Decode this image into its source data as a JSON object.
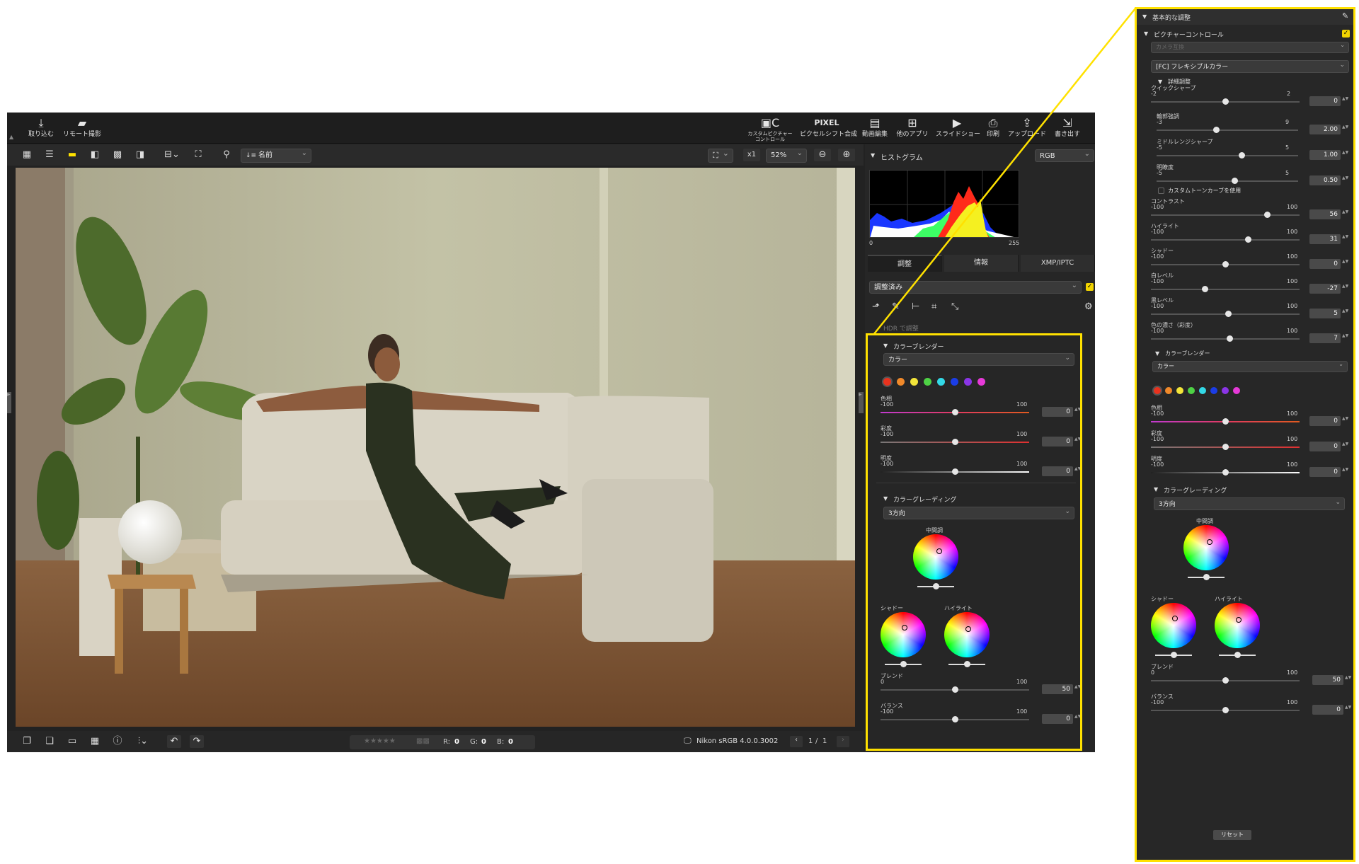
{
  "app": {
    "topbar_left": [
      {
        "label": "取り込む",
        "icon": "import-icon"
      },
      {
        "label": "リモート撮影",
        "icon": "remote-shoot-icon"
      }
    ],
    "topbar_right": [
      {
        "label": "カスタムピクチャーコントロール",
        "icon": "picture-control-icon"
      },
      {
        "label": "ピクセルシフト合成",
        "icon": "pixel-shift-icon",
        "glyph": "PIXEL"
      },
      {
        "label": "動画編集",
        "icon": "movie-edit-icon"
      },
      {
        "label": "他のアプリ",
        "icon": "other-apps-icon"
      },
      {
        "label": "スライドショー",
        "icon": "slideshow-icon"
      },
      {
        "label": "印刷",
        "icon": "print-icon"
      },
      {
        "label": "アップロード",
        "icon": "upload-icon"
      },
      {
        "label": "書き出す",
        "icon": "export-icon"
      }
    ],
    "sort_label": "名前",
    "zoom_label": "x1",
    "zoom_value": "52%",
    "histogram": {
      "title": "ヒストグラム",
      "channel": "RGB",
      "min": "0",
      "max": "255"
    },
    "tabs": [
      "調整",
      "情報",
      "XMP/IPTC"
    ],
    "adjust_preset": "調整済み",
    "hdr": "HDR で調整",
    "status": {
      "r_label": "R:",
      "r": "0",
      "g_label": "G:",
      "g": "0",
      "b_label": "B:",
      "b": "0",
      "profile": "Nikon sRGB 4.0.0.3002",
      "page": "1",
      "sep": "/",
      "total": "1"
    },
    "color_blender": {
      "title": "カラーブレンダー",
      "mode": "カラー",
      "colors": [
        "#e8321e",
        "#f0892a",
        "#f3e53a",
        "#4ed245",
        "#33d9e6",
        "#1b3de6",
        "#8a35e6",
        "#e63ad8"
      ],
      "sliders": [
        {
          "label": "色相",
          "min": "-100",
          "max": "100",
          "value": "0",
          "pos": 0.5
        },
        {
          "label": "彩度",
          "min": "-100",
          "max": "100",
          "value": "0",
          "pos": 0.5
        },
        {
          "label": "明度",
          "min": "-100",
          "max": "100",
          "value": "0",
          "pos": 0.5
        }
      ]
    },
    "color_grading": {
      "title": "カラーグレーディング",
      "mode": "3方向",
      "mid": "中間調",
      "shadow": "シャドー",
      "highlight": "ハイライト",
      "blend": {
        "label": "ブレンド",
        "min": "0",
        "max": "100",
        "value": "50",
        "pos": 0.5
      },
      "balance": {
        "label": "バランス",
        "min": "-100",
        "max": "100",
        "value": "0",
        "pos": 0.5
      }
    }
  },
  "zoom_panel": {
    "title": "基本的な調整",
    "picture_control": "ピクチャーコントロール",
    "camera_compat": "カメラ互換",
    "preset": "[FC] フレキシブルカラー",
    "detail": "詳細調整",
    "quick_sharp": {
      "label": "クイックシャープ",
      "min": "-2",
      "max": "2",
      "value": "0",
      "pos": 0.5
    },
    "detail_sliders": [
      {
        "label": "輪郭強調",
        "min": "-3",
        "max": "9",
        "value": "2.00",
        "pos": 0.42
      },
      {
        "label": "ミドルレンジシャープ",
        "min": "-5",
        "max": "5",
        "value": "1.00",
        "pos": 0.6
      },
      {
        "label": "明瞭度",
        "min": "-5",
        "max": "5",
        "value": "0.50",
        "pos": 0.55
      }
    ],
    "custom_curve": "カスタムトーンカーブを使用",
    "tone_sliders": [
      {
        "label": "コントラスト",
        "min": "-100",
        "max": "100",
        "value": "56",
        "pos": 0.78
      },
      {
        "label": "ハイライト",
        "min": "-100",
        "max": "100",
        "value": "31",
        "pos": 0.65
      },
      {
        "label": "シャドー",
        "min": "-100",
        "max": "100",
        "value": "0",
        "pos": 0.5
      },
      {
        "label": "白レベル",
        "min": "-100",
        "max": "100",
        "value": "-27",
        "pos": 0.36
      },
      {
        "label": "黒レベル",
        "min": "-100",
        "max": "100",
        "value": "5",
        "pos": 0.52
      },
      {
        "label": "色の濃さ（彩度）",
        "min": "-100",
        "max": "100",
        "value": "7",
        "pos": 0.53
      }
    ],
    "reset": "リセット"
  },
  "colors": {
    "highlight": "#ffe100",
    "accent_check": "#f2d400"
  }
}
